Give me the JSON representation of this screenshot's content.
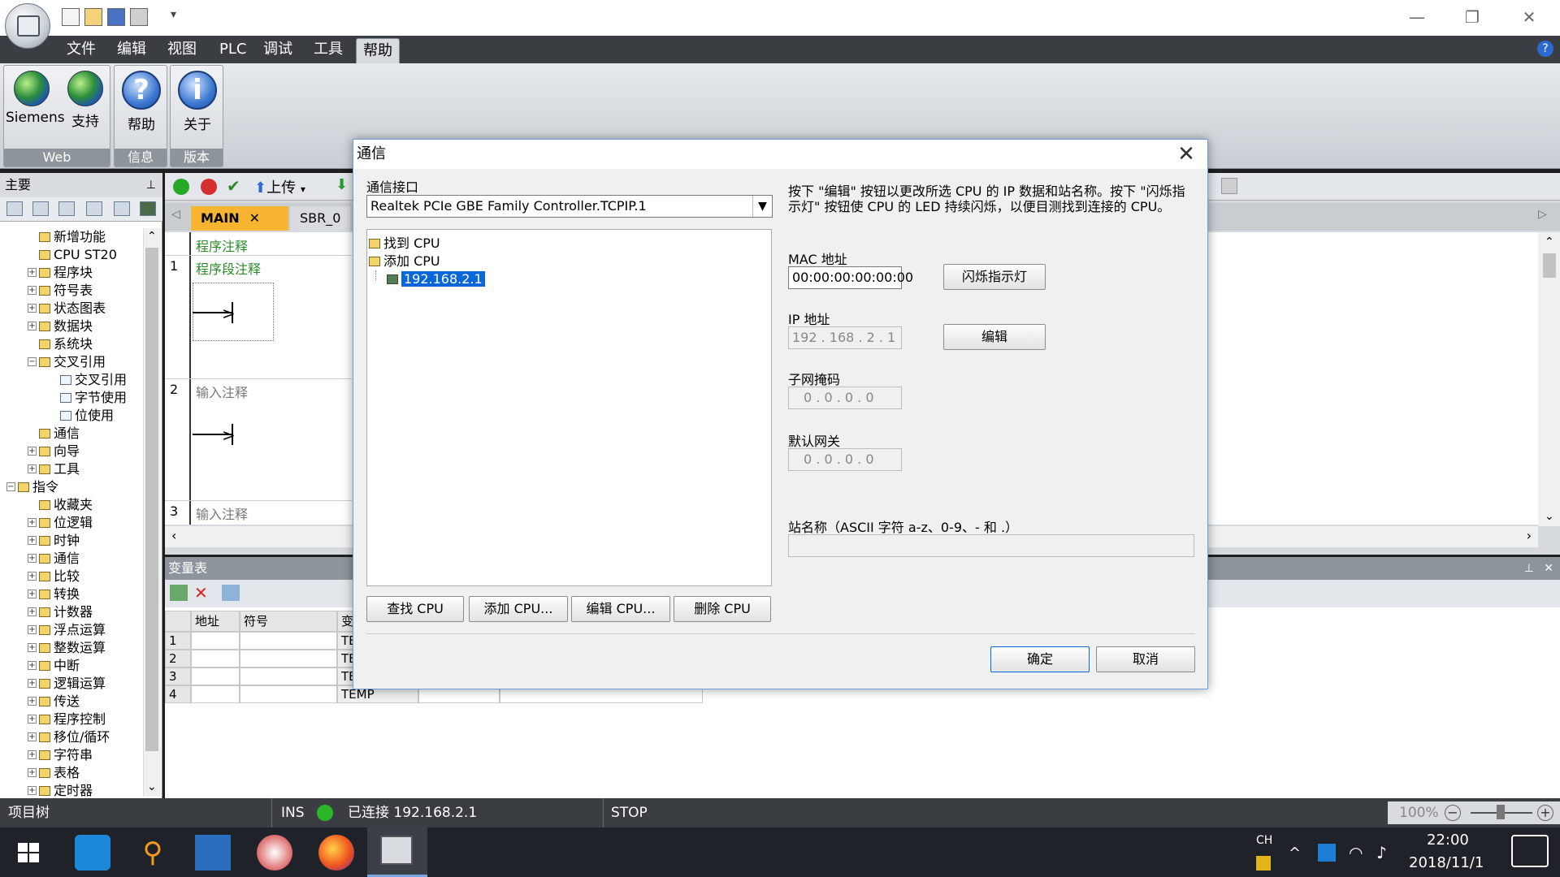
{
  "app": {
    "menus": [
      "文件",
      "编辑",
      "视图",
      "PLC",
      "调试",
      "工具",
      "帮助"
    ],
    "active_menu": "帮助",
    "window_controls": {
      "minimize": "—",
      "restore": "❐",
      "close": "✕"
    },
    "help_icon": "?"
  },
  "ribbon": {
    "groups": [
      {
        "label": "Web",
        "buttons": [
          "Siemens",
          "支持"
        ]
      },
      {
        "label": "信息",
        "buttons": [
          "帮助"
        ]
      },
      {
        "label": "版本",
        "buttons": [
          "关于"
        ]
      }
    ]
  },
  "left_panel": {
    "title": "主要",
    "tree": [
      {
        "label": "新增功能",
        "level": 1
      },
      {
        "label": "CPU ST20",
        "level": 1
      },
      {
        "label": "程序块",
        "level": 1,
        "exp": "+"
      },
      {
        "label": "符号表",
        "level": 1,
        "exp": "+"
      },
      {
        "label": "状态图表",
        "level": 1,
        "exp": "+"
      },
      {
        "label": "数据块",
        "level": 1,
        "exp": "+"
      },
      {
        "label": "系统块",
        "level": 1
      },
      {
        "label": "交叉引用",
        "level": 1,
        "exp": "−"
      },
      {
        "label": "交叉引用",
        "level": 2
      },
      {
        "label": "字节使用",
        "level": 2
      },
      {
        "label": "位使用",
        "level": 2
      },
      {
        "label": "通信",
        "level": 1
      },
      {
        "label": "向导",
        "level": 1,
        "exp": "+"
      },
      {
        "label": "工具",
        "level": 1,
        "exp": "+"
      },
      {
        "label": "指令",
        "level": 0,
        "exp": "−"
      },
      {
        "label": "收藏夹",
        "level": 1
      },
      {
        "label": "位逻辑",
        "level": 1,
        "exp": "+"
      },
      {
        "label": "时钟",
        "level": 1,
        "exp": "+"
      },
      {
        "label": "通信",
        "level": 1,
        "exp": "+"
      },
      {
        "label": "比较",
        "level": 1,
        "exp": "+"
      },
      {
        "label": "转换",
        "level": 1,
        "exp": "+"
      },
      {
        "label": "计数器",
        "level": 1,
        "exp": "+"
      },
      {
        "label": "浮点运算",
        "level": 1,
        "exp": "+"
      },
      {
        "label": "整数运算",
        "level": 1,
        "exp": "+"
      },
      {
        "label": "中断",
        "level": 1,
        "exp": "+"
      },
      {
        "label": "逻辑运算",
        "level": 1,
        "exp": "+"
      },
      {
        "label": "传送",
        "level": 1,
        "exp": "+"
      },
      {
        "label": "程序控制",
        "level": 1,
        "exp": "+"
      },
      {
        "label": "移位/循环",
        "level": 1,
        "exp": "+"
      },
      {
        "label": "字符串",
        "level": 1,
        "exp": "+"
      },
      {
        "label": "表格",
        "level": 1,
        "exp": "+"
      },
      {
        "label": "定时器",
        "level": 1,
        "exp": "+"
      }
    ]
  },
  "editor": {
    "upload_label": "上传",
    "tabs": [
      "MAIN",
      "SBR_0"
    ],
    "program_comment": "程序注释",
    "networks": [
      {
        "num": "1",
        "comment": "程序段注释"
      },
      {
        "num": "2",
        "comment": "输入注释"
      },
      {
        "num": "3",
        "comment": "输入注释"
      }
    ]
  },
  "var_table": {
    "title": "变量表",
    "headers": [
      "地址",
      "符号",
      "变"
    ],
    "rows": [
      {
        "n": "1",
        "type": "TE"
      },
      {
        "n": "2",
        "type": "TE"
      },
      {
        "n": "3",
        "type": "TE"
      },
      {
        "n": "4",
        "type": "TEMP"
      }
    ]
  },
  "status": {
    "project_tree": "项目树",
    "ins": "INS",
    "connected": "已连接 192.168.2.1",
    "mode": "STOP",
    "zoom": "100%"
  },
  "taskbar": {
    "lang": "CH",
    "time": "22:00",
    "date": "2018/11/1"
  },
  "dialog": {
    "title": "通信",
    "interface_label": "通信接口",
    "interface_value": "Realtek PCIe GBE Family Controller.TCPIP.1",
    "tree": [
      "找到 CPU",
      "添加 CPU",
      "192.168.2.1"
    ],
    "info": "按下 \"编辑\" 按钮以更改所选 CPU 的 IP 数据和站名称。按下 \"闪烁指示灯\" 按钮使 CPU 的 LED 持续闪烁，以便目测找到连接的 CPU。",
    "mac_label": "MAC 地址",
    "mac_value": "00:00:00:00:00:00",
    "blink_button": "闪烁指示灯",
    "ip_label": "IP 地址",
    "ip_value": "192 . 168 .  2  .  1",
    "edit_button": "编辑",
    "subnet_label": "子网掩码",
    "subnet_value": "0  .  0  .  0  .  0",
    "gateway_label": "默认网关",
    "gateway_value": "0  .  0  .  0  .  0",
    "station_label": "站名称（ASCII 字符 a-z、0-9、- 和 .）",
    "station_value": "",
    "buttons": [
      "查找 CPU",
      "添加 CPU...",
      "编辑 CPU...",
      "删除 CPU"
    ],
    "ok": "确定",
    "cancel": "取消"
  }
}
